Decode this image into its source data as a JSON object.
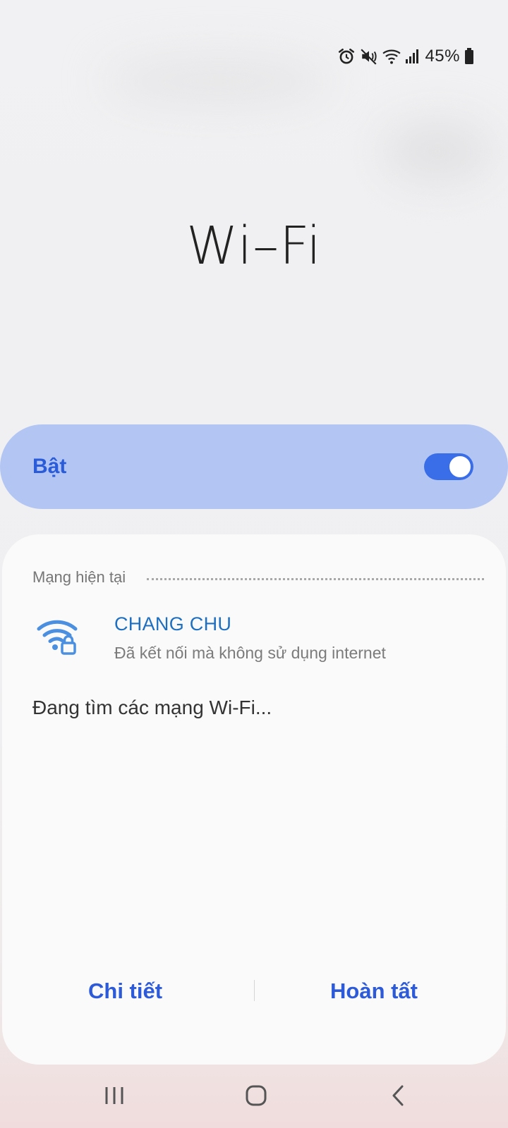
{
  "status_bar": {
    "icons": [
      "alarm-icon",
      "mute-icon",
      "wifi-signal-icon",
      "cell-signal-icon",
      "battery-icon"
    ],
    "battery_percent": "45%"
  },
  "page": {
    "title": "Wi–Fi"
  },
  "master_toggle": {
    "label": "Bật",
    "state": "on",
    "accent": "#3a6ee8"
  },
  "current_network": {
    "section_title": "Mạng hiện tại",
    "name": "CHANG CHU",
    "status": "Đã kết nối mà không sử dụng internet",
    "icon": "wifi-lock-icon"
  },
  "scanning": {
    "text": "Đang tìm các mạng Wi-Fi..."
  },
  "actions": {
    "details_label": "Chi tiết",
    "done_label": "Hoàn tất"
  },
  "nav_bar": {
    "icons": [
      "recent-apps-icon",
      "home-icon",
      "back-icon"
    ]
  },
  "colors": {
    "card_bg": "#b3c6f3",
    "link_blue": "#2c5ad8",
    "network_blue": "#1f6fc0"
  }
}
